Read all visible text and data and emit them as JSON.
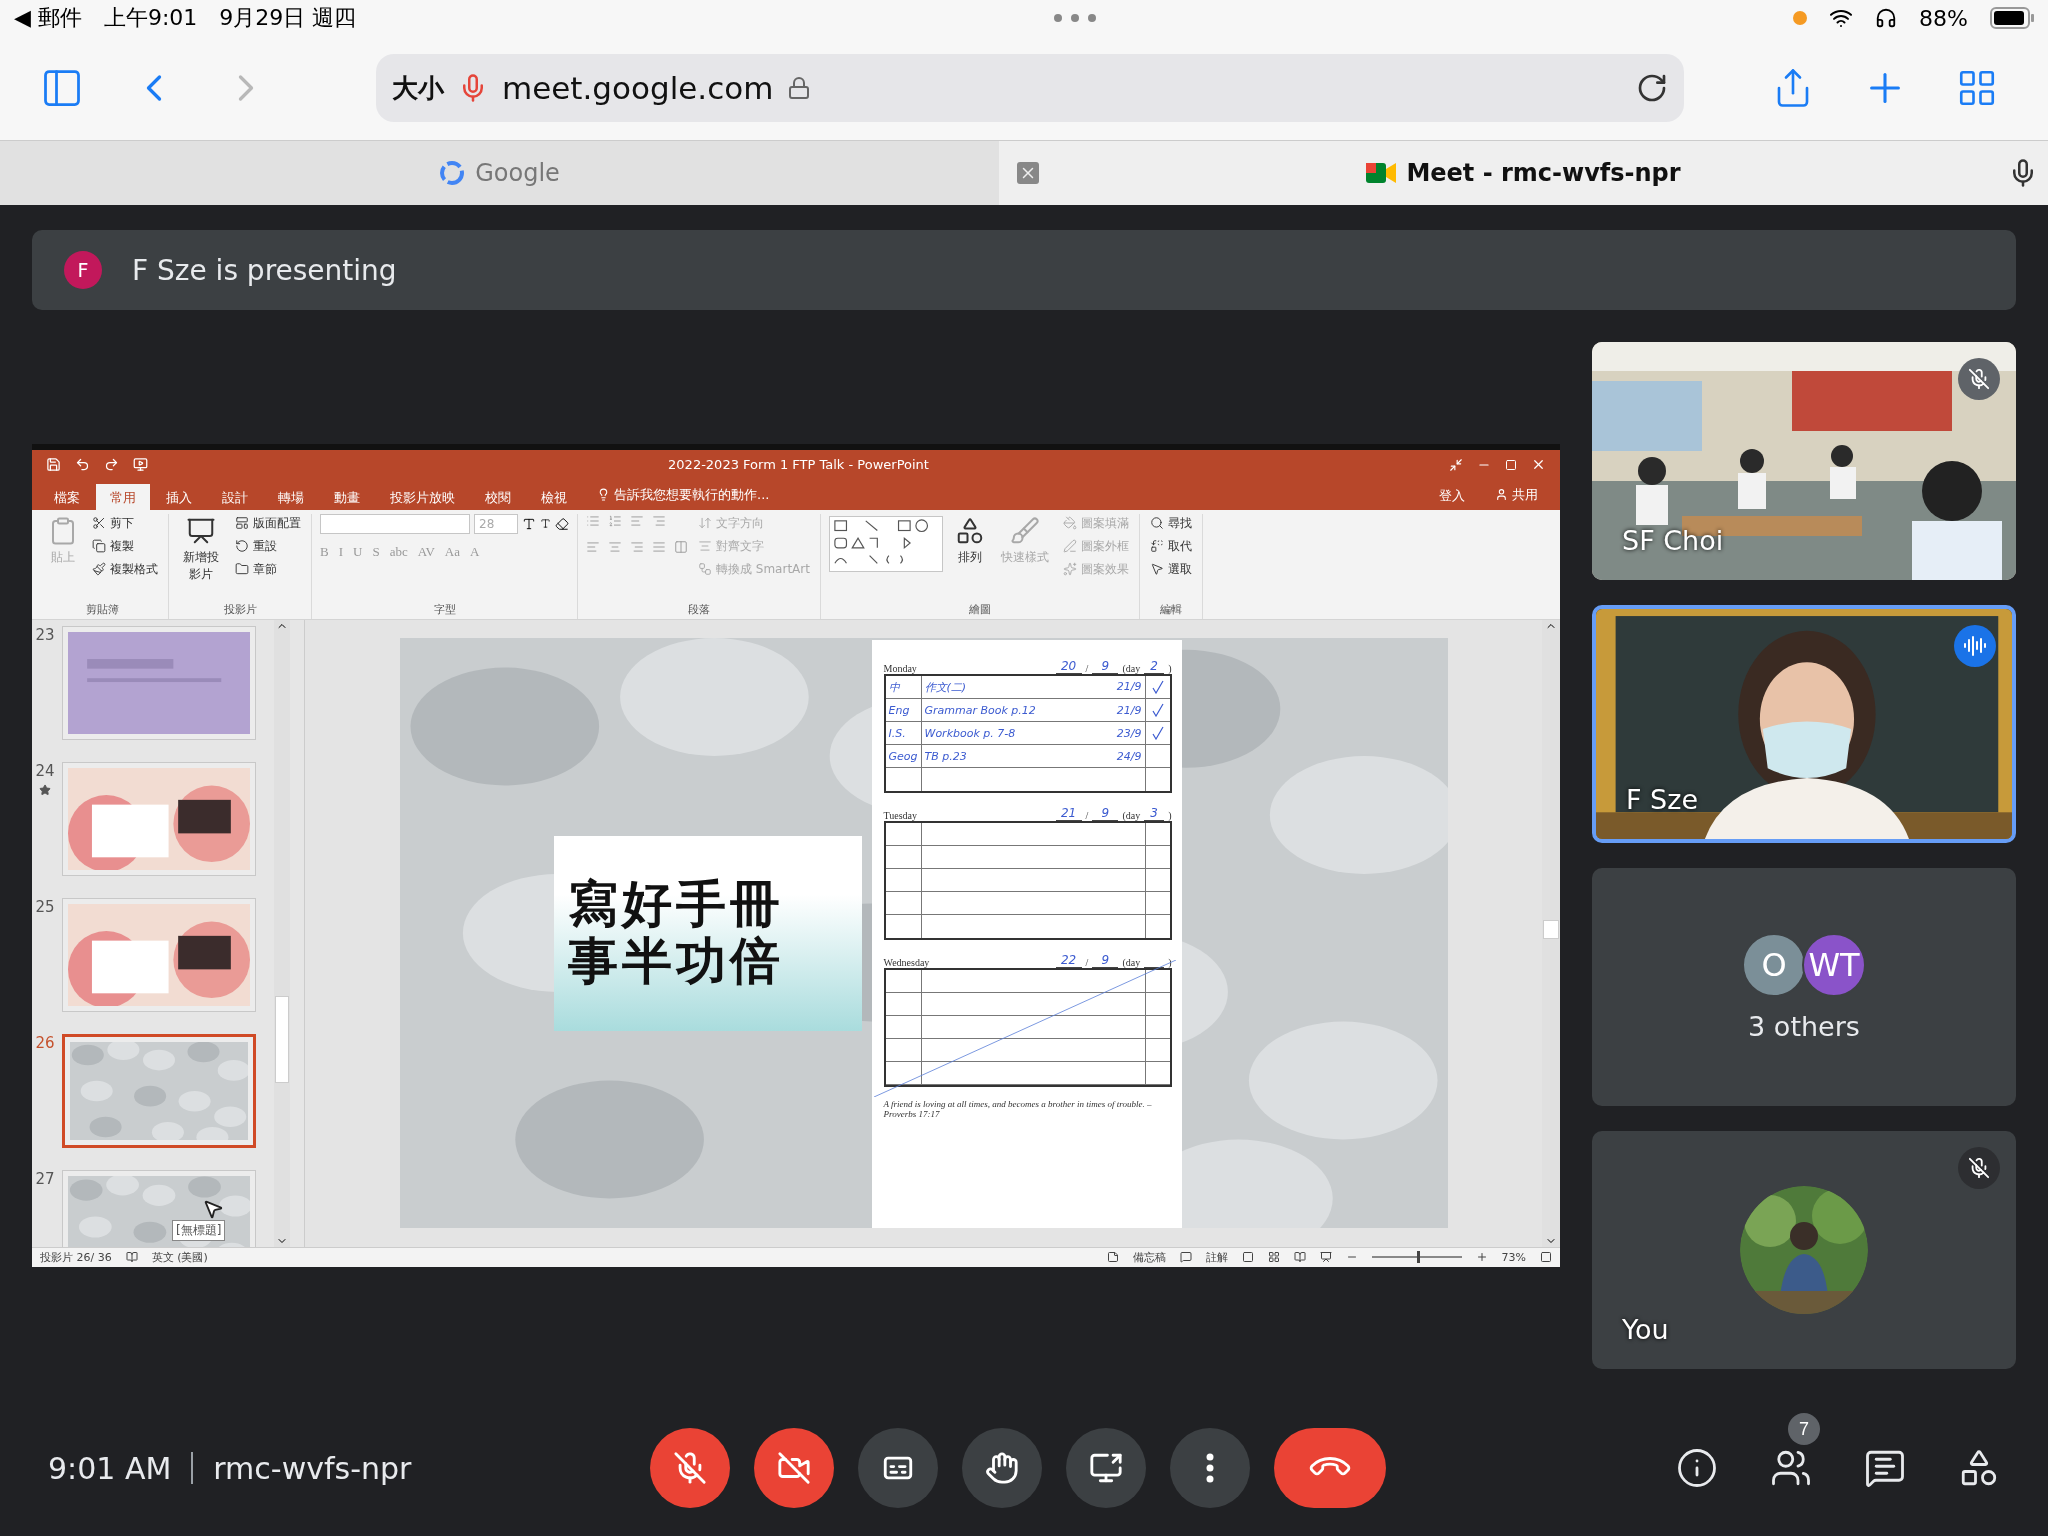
{
  "status_bar": {
    "back_app": "◀ 郵件",
    "time": "上午9:01",
    "date": "9月29日 週四",
    "battery": "88%"
  },
  "browser": {
    "text_size": "大小",
    "url": "meet.google.com",
    "tabs": [
      {
        "title": "Google",
        "selected": false
      },
      {
        "title": "Meet - rmc-wvfs-npr",
        "selected": true
      }
    ]
  },
  "presenting_banner": {
    "avatar": "F",
    "text": "F Sze is presenting"
  },
  "powerpoint": {
    "title": "2022-2023 Form 1 FTP Talk - PowerPoint",
    "ribbon_tabs": [
      {
        "label": "檔案",
        "selected": false
      },
      {
        "label": "常用",
        "selected": true
      },
      {
        "label": "插入",
        "selected": false
      },
      {
        "label": "設計",
        "selected": false
      },
      {
        "label": "轉場",
        "selected": false
      },
      {
        "label": "動畫",
        "selected": false
      },
      {
        "label": "投影片放映",
        "selected": false
      },
      {
        "label": "校閱",
        "selected": false
      },
      {
        "label": "檢視",
        "selected": false
      }
    ],
    "tell_me": "告訴我您想要執行的動作...",
    "sign_in": "登入",
    "share": "共用",
    "ribbon_groups": [
      {
        "kind": "clipboard",
        "label": "剪貼簿",
        "big": [
          {
            "label": "貼上",
            "disabled": true
          }
        ],
        "items": [
          {
            "label": "剪下",
            "disabled": false
          },
          {
            "label": "複製",
            "disabled": false
          },
          {
            "label": "複製格式",
            "disabled": false
          }
        ]
      },
      {
        "kind": "slides",
        "label": "投影片",
        "big": [
          {
            "label": "新增投影片",
            "disabled": false
          }
        ],
        "items": [
          {
            "label": "版面配置",
            "disabled": false
          },
          {
            "label": "重設",
            "disabled": false
          },
          {
            "label": "章節",
            "disabled": false
          }
        ]
      },
      {
        "kind": "font",
        "label": "字型",
        "font_size": "28",
        "buttons": [
          "B",
          "I",
          "U",
          "S",
          "abc",
          "AV",
          "Aa",
          "A"
        ]
      },
      {
        "kind": "paragraph",
        "label": "段落",
        "items": [
          {
            "label": "文字方向",
            "disabled": true
          },
          {
            "label": "對齊文字",
            "disabled": true
          },
          {
            "label": "轉換成 SmartArt",
            "disabled": true
          }
        ]
      },
      {
        "kind": "drawing",
        "label": "繪圖",
        "big": [
          {
            "label": "排列",
            "disabled": false
          },
          {
            "label": "快速樣式",
            "disabled": true
          }
        ],
        "items": [
          {
            "label": "圖案填滿",
            "disabled": true
          },
          {
            "label": "圖案外框",
            "disabled": true
          },
          {
            "label": "圖案效果",
            "disabled": true
          }
        ]
      },
      {
        "kind": "editing",
        "label": "編輯",
        "items": [
          {
            "label": "尋找",
            "disabled": false
          },
          {
            "label": "取代",
            "disabled": false
          },
          {
            "label": "選取",
            "disabled": false
          }
        ]
      }
    ],
    "thumbnails": [
      {
        "number": "23",
        "kind": "purple",
        "selected": false,
        "starred": false
      },
      {
        "number": "24",
        "kind": "hearts",
        "selected": false,
        "starred": true
      },
      {
        "number": "25",
        "kind": "hearts",
        "selected": false,
        "starred": false
      },
      {
        "number": "26",
        "kind": "stones",
        "selected": true,
        "starred": false
      },
      {
        "number": "27",
        "kind": "stones",
        "selected": false,
        "starred": false
      }
    ],
    "tooltip": "[無標題]",
    "slide": {
      "title_lines": [
        "寫好手冊",
        "事半功倍"
      ],
      "planner": {
        "days": [
          {
            "name": "Monday",
            "date": "20",
            "separator": "/",
            "month": "9",
            "day_prefix": "(day",
            "day": "2",
            "day_suffix": ")",
            "crossed": false,
            "rows": [
              {
                "subject": "中",
                "task": "作文(二)",
                "due": "21/9",
                "done": true
              },
              {
                "subject": "Eng",
                "task": "Grammar Book p.12",
                "due": "21/9",
                "done": true
              },
              {
                "subject": "I.S.",
                "task": "Workbook p. 7-8",
                "due": "23/9",
                "done": true
              },
              {
                "subject": "Geog",
                "task": "TB p.23",
                "due": "24/9",
                "done": false
              }
            ]
          },
          {
            "name": "Tuesday",
            "date": "21",
            "separator": "/",
            "month": "9",
            "day_prefix": "(day",
            "day": "3",
            "day_suffix": ")",
            "crossed": false
          },
          {
            "name": "Wednesday",
            "date": "22",
            "separator": "/",
            "month": "9",
            "day_prefix": "(day",
            "day_suffix": ")",
            "crossed": true
          }
        ],
        "quote": "A friend is loving at all times, and becomes a brother in times of trouble. – Proverbs 17:17"
      }
    },
    "status": {
      "slide_count": "投影片 26/ 36",
      "language": "英文 (美國)",
      "notes": "備忘稿",
      "comments": "註解",
      "zoom": "73%",
      "zoom_slider": {
        "level": 0.5
      }
    }
  },
  "participants": [
    {
      "kind": "classroom",
      "name": "SF Choi",
      "muted": true,
      "speaking": false
    },
    {
      "kind": "presenter",
      "name": "F Sze",
      "muted": false,
      "speaking": true
    },
    {
      "kind": "others",
      "label": "3 others",
      "avatars": [
        {
          "initial": "O",
          "color": "#7b8f98"
        },
        {
          "initial": "WT",
          "color": "#8a53c9"
        }
      ]
    },
    {
      "kind": "self",
      "name": "You",
      "muted": true,
      "speaking": false
    }
  ],
  "meeting": {
    "time": "9:01 AM",
    "code": "rmc-wvfs-npr",
    "people_count": "7",
    "controls": [
      {
        "kind": "mic",
        "on": false
      },
      {
        "kind": "camera",
        "on": false
      },
      {
        "kind": "captions"
      },
      {
        "kind": "hand"
      },
      {
        "kind": "present"
      },
      {
        "kind": "more"
      },
      {
        "kind": "leave"
      }
    ]
  }
}
